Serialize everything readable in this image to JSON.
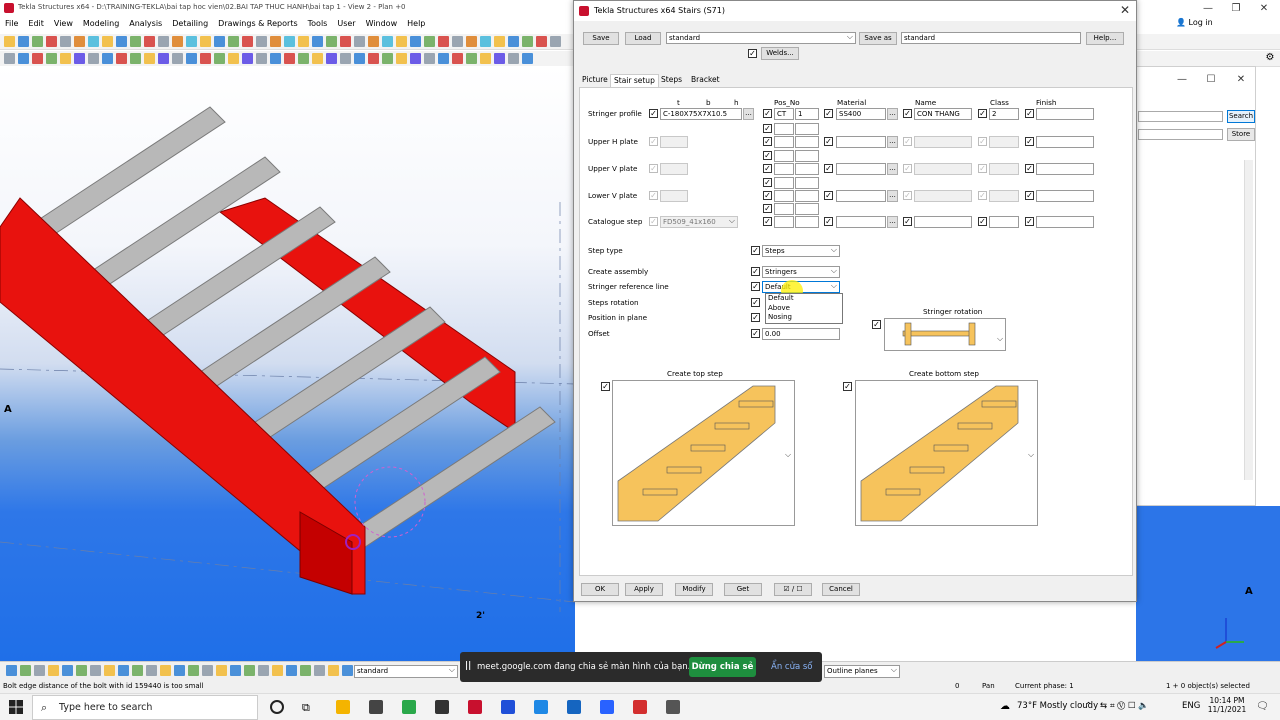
{
  "app": {
    "title": "Tekla Structures x64 - D:\\TRAINING-TEKLA\\bai tap hoc vien\\02.BAI TAP THUC HANH\\bai tap 1  - View 2 - Plan +0",
    "menu": [
      "File",
      "Edit",
      "View",
      "Modeling",
      "Analysis",
      "Detailing",
      "Drawings & Reports",
      "Tools",
      "User",
      "Window",
      "Help"
    ],
    "login": "Log in"
  },
  "viewport": {
    "grid_label_a_left": "A",
    "grid_label_a_right": "A",
    "grid_label_2": "2'"
  },
  "bg_window": {
    "search_btn": "Search",
    "store_btn": "Store"
  },
  "dialog": {
    "title": "Tekla Structures x64  Stairs (S71)",
    "save_btn": "Save",
    "load_btn": "Load",
    "load_value": "standard",
    "save_as_btn": "Save as",
    "save_as_value": "standard",
    "help_btn": "Help...",
    "welds_btn": "Welds...",
    "tabs": [
      "Picture",
      "Stair setup",
      "Steps",
      "Bracket"
    ],
    "columns": {
      "t": "t",
      "b": "b",
      "h": "h",
      "pos_no": "Pos_No",
      "material": "Material",
      "name": "Name",
      "class": "Class",
      "finish": "Finish"
    },
    "rows": [
      {
        "label": "Stringer profile",
        "value": "C-180X75X7X10.5",
        "pos_prefix": "CT",
        "pos_no": "1",
        "material": "SS400",
        "name": "CON THANG",
        "class": "2"
      },
      {
        "label": "Upper H plate"
      },
      {
        "label": "Upper V plate"
      },
      {
        "label": "Lower V plate"
      },
      {
        "label": "Catalogue step",
        "value": "FD509_41x160"
      }
    ],
    "step_type": {
      "label": "Step type",
      "value": "Steps"
    },
    "create_assembly": {
      "label": "Create assembly",
      "value": "Stringers"
    },
    "stringer_ref": {
      "label": "Stringer reference line",
      "value": "Default",
      "options": [
        "Default",
        "Above",
        "Nosing"
      ]
    },
    "steps_rotation": {
      "label": "Steps rotation"
    },
    "position_in_plane": {
      "label": "Position in plane"
    },
    "offset": {
      "label": "Offset",
      "value": "0.00"
    },
    "stringer_rotation_label": "Stringer rotation",
    "create_top_step": "Create top step",
    "create_bottom_step": "Create bottom step",
    "footer": {
      "ok": "OK",
      "apply": "Apply",
      "modify": "Modify",
      "get": "Get",
      "toggle": "☑ / ☐",
      "cancel": "Cancel"
    }
  },
  "statusbar": {
    "standard_value": "standard",
    "outline_planes": "Outline planes",
    "message": "Bolt edge distance of the bolt with id 159440 is too small",
    "zero": "0",
    "pan": "Pan",
    "phase": "Current phase: 1",
    "selected": "1 + 0 object(s) selected"
  },
  "share_bar": {
    "pause_icon": "||",
    "message": "meet.google.com đang chia sẻ màn hình của bạn.",
    "stop": "Dừng chia sẻ",
    "hide": "Ẩn cửa sổ"
  },
  "taskbar": {
    "search_placeholder": "Type here to search",
    "weather": "73°F  Mostly cloudy",
    "lang": "ENG",
    "time": "10:14 PM",
    "date": "11/1/2021"
  },
  "colors": {
    "stringer": "#e8120e",
    "step": "#b8b8b8",
    "step_fill": "#f6c35c",
    "share_green": "#1e8e3e"
  }
}
